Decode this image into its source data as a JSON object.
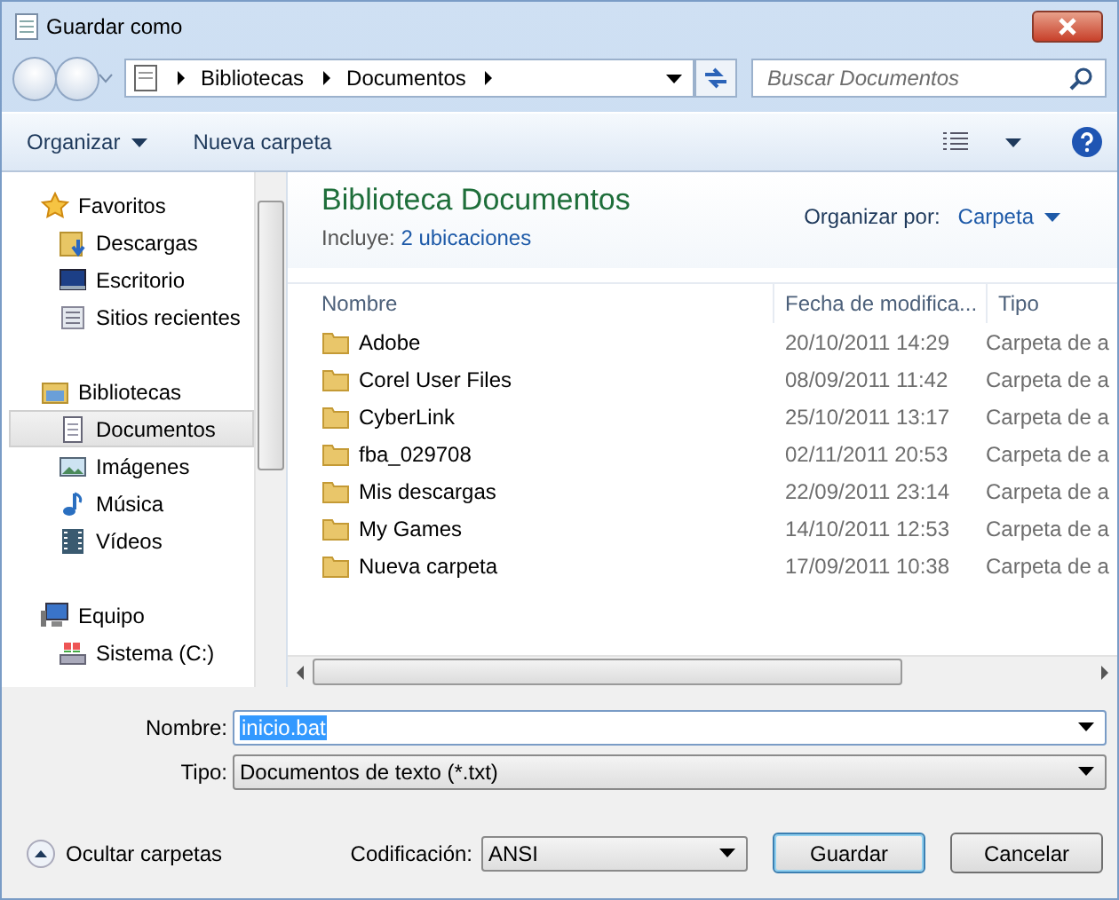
{
  "window": {
    "title": "Guardar como"
  },
  "address": {
    "path": [
      "Bibliotecas",
      "Documentos"
    ]
  },
  "search": {
    "placeholder": "Buscar Documentos"
  },
  "toolbar": {
    "organize": "Organizar",
    "new_folder": "Nueva carpeta"
  },
  "sidebar": {
    "groups": [
      {
        "label": "Favoritos",
        "kind": "star",
        "selected": false,
        "children": [
          {
            "label": "Descargas",
            "kind": "downloads",
            "selected": false
          },
          {
            "label": "Escritorio",
            "kind": "desktop",
            "selected": false
          },
          {
            "label": "Sitios recientes",
            "kind": "recent",
            "selected": false
          }
        ]
      },
      {
        "label": "Bibliotecas",
        "kind": "library",
        "selected": false,
        "children": [
          {
            "label": "Documentos",
            "kind": "document",
            "selected": true
          },
          {
            "label": "Imágenes",
            "kind": "images",
            "selected": false
          },
          {
            "label": "Música",
            "kind": "music",
            "selected": false
          },
          {
            "label": "Vídeos",
            "kind": "video",
            "selected": false
          }
        ]
      },
      {
        "label": "Equipo",
        "kind": "computer",
        "selected": false,
        "children": [
          {
            "label": "Sistema (C:)",
            "kind": "drive",
            "selected": false
          }
        ]
      }
    ]
  },
  "library": {
    "title": "Biblioteca Documentos",
    "includes_label": "Incluye:",
    "includes_link": "2 ubicaciones",
    "arrange_label": "Organizar por:",
    "arrange_value": "Carpeta"
  },
  "table": {
    "columns": [
      "Nombre",
      "Fecha de modifica...",
      "Tipo"
    ],
    "rows": [
      {
        "name": "Adobe",
        "date": "20/10/2011 14:29",
        "type": "Carpeta de a"
      },
      {
        "name": "Corel User Files",
        "date": "08/09/2011 11:42",
        "type": "Carpeta de a"
      },
      {
        "name": "CyberLink",
        "date": "25/10/2011 13:17",
        "type": "Carpeta de a"
      },
      {
        "name": "fba_029708",
        "date": "02/11/2011 20:53",
        "type": "Carpeta de a"
      },
      {
        "name": "Mis descargas",
        "date": "22/09/2011 23:14",
        "type": "Carpeta de a"
      },
      {
        "name": "My Games",
        "date": "14/10/2011 12:53",
        "type": "Carpeta de a"
      },
      {
        "name": "Nueva carpeta",
        "date": "17/09/2011 10:38",
        "type": "Carpeta de a"
      }
    ]
  },
  "form": {
    "name_label": "Nombre:",
    "name_value": "inicio.bat",
    "type_label": "Tipo:",
    "type_value": "Documentos de texto (*.txt)",
    "encoding_label": "Codificación:",
    "encoding_value": "ANSI"
  },
  "hide_folders": "Ocultar carpetas",
  "buttons": [
    {
      "label": "Guardar",
      "kind": "default"
    },
    {
      "label": "Cancelar",
      "kind": "normal"
    }
  ]
}
